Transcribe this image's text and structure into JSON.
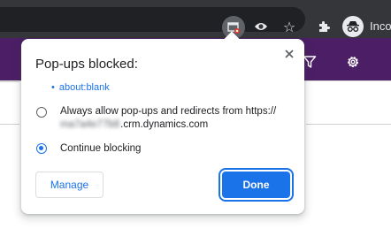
{
  "browser": {
    "incognito_label": "Incog",
    "icons": [
      "popup-blocked-icon",
      "eye-icon",
      "star-icon",
      "extensions-icon",
      "incognito-icon"
    ]
  },
  "appbar": {
    "icons": [
      "filter-icon",
      "gear-icon"
    ],
    "color": "#4b1e65"
  },
  "dialog": {
    "title": "Pop-ups blocked:",
    "blocked_link": "about:blank",
    "option_allow_line1": "Always allow pop-ups and redirects from https://",
    "option_allow_host_hidden": "ma7a4e77b8",
    "option_allow_line2_suffix": ".crm.dynamics.com",
    "option_continue": "Continue blocking",
    "selected_option": "continue",
    "manage_label": "Manage",
    "done_label": "Done",
    "accent": "#1a73e8"
  }
}
